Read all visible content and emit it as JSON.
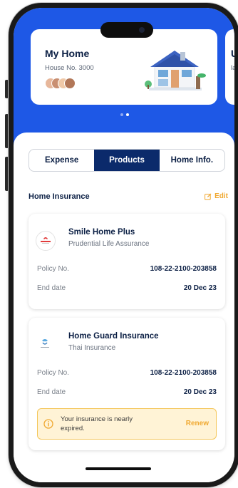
{
  "home_card": {
    "title": "My Home",
    "house_number": "House No. 3000"
  },
  "next_card": {
    "title_fragment": "U",
    "sub_fragment": "la"
  },
  "carousel": {
    "page_count": 2,
    "active_index": 1
  },
  "tabs": [
    {
      "label": "Expense",
      "active": false
    },
    {
      "label": "Products",
      "active": true
    },
    {
      "label": "Home Info.",
      "active": false
    }
  ],
  "section": {
    "title": "Home Insurance",
    "edit_label": "Edit"
  },
  "policies": [
    {
      "name": "Smile Home Plus",
      "company": "Prudential Life Assurance",
      "logo_text": "PRUDENTIAL",
      "policy_label": "Policy No.",
      "policy_no": "108-22-2100-203858",
      "end_label": "End date",
      "end_date": "20 Dec 23"
    },
    {
      "name": "Home Guard Insurance",
      "company": "Thai Insurance",
      "logo_text": "",
      "policy_label": "Policy No.",
      "policy_no": "108-22-2100-203858",
      "end_label": "End date",
      "end_date": "20 Dec 23",
      "warning": "Your insurance is nearly expired.",
      "warning_action": "Renew"
    }
  ],
  "colors": {
    "brand_blue": "#1e58e6",
    "navy": "#0b2a6b",
    "accent_orange": "#f0a830",
    "warning_bg": "#fff3d6"
  },
  "icons": {
    "edit": "edit-icon",
    "info": "info-icon",
    "house": "house-illustration-icon"
  }
}
